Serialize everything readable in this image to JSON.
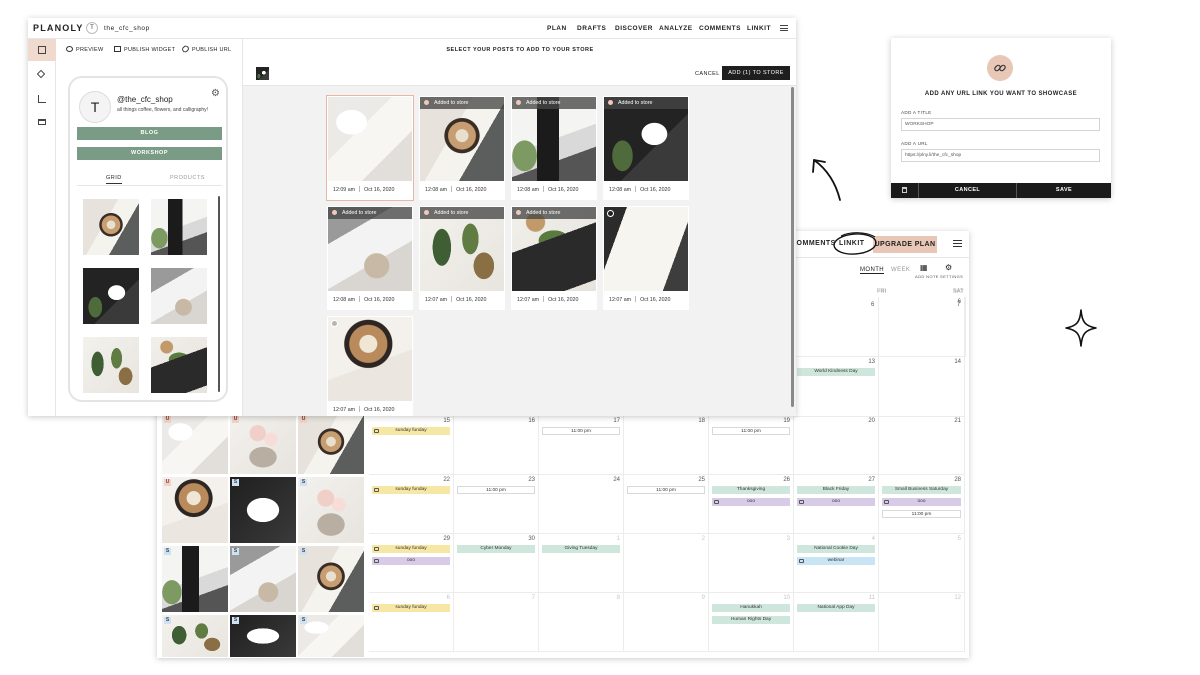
{
  "calendar": {
    "nav": {
      "comments": "COMMENTS",
      "linkit": "LINKIT",
      "upgrade": "UPGRADE PLAN"
    },
    "views": {
      "month": "MONTH",
      "week": "WEEK",
      "add_note": "ADD NOTE",
      "settings": "SETTINGS"
    },
    "day_heads": {
      "fri": "FRI",
      "sat": "SAT"
    },
    "row1": [
      "6",
      "7"
    ],
    "row2": [
      "13",
      "14"
    ],
    "row3": [
      "15",
      "16",
      "17",
      "18",
      "19",
      "20",
      "21"
    ],
    "row4": [
      "22",
      "23",
      "24",
      "25",
      "26",
      "27",
      "28"
    ],
    "row5": [
      "29",
      "30",
      "1",
      "2",
      "3",
      "4",
      "5"
    ],
    "row6": [
      "6",
      "7",
      "8",
      "9",
      "10",
      "11",
      "12"
    ],
    "events": {
      "world_kindness": "World Kindness Day",
      "sunday_funday": "sunday funday",
      "time_1100": "11:00 pm",
      "thanksgiving": "Thanksgiving",
      "black_friday": "Black Friday",
      "small_business": "Small Business Saturday",
      "ooo": "ooo",
      "cyber_monday": "Cyber Monday",
      "giving_tuesday": "Giving Tuesday",
      "national_cookie": "National Cookie Day",
      "webinar": "webinar",
      "hanukkah": "Hanukkah",
      "human_rights": "Human Rights Day",
      "national_app": "National App Day"
    },
    "badges": {
      "u": "U",
      "s": "S"
    }
  },
  "app": {
    "brand": "PLANOLY",
    "account_initial": "T",
    "account_name": "the_cfc_shop",
    "nav": [
      "PLAN",
      "DRAFTS",
      "DISCOVER",
      "ANALYZE",
      "COMMENTS",
      "LINKIT"
    ],
    "toolbar": {
      "preview": "PREVIEW",
      "publish_widget": "PUBLISH WIDGET",
      "publish_url": "PUBLISH URL"
    }
  },
  "profile": {
    "initial": "T",
    "handle": "@the_cfc_shop",
    "bio": "all things coffee, flowers, and calligraphy!",
    "links": [
      "BLOG",
      "WORKSHOP"
    ],
    "tabs": [
      "GRID",
      "PRODUCTS"
    ]
  },
  "picker": {
    "heading": "SELECT YOUR POSTS TO ADD TO YOUR STORE",
    "cancel": "CANCEL",
    "add_button": "ADD (1) TO STORE",
    "added_label": "Added to store",
    "date": "Oct 16, 2020",
    "posts": [
      {
        "time": "12:09 am"
      },
      {
        "time": "12:08 am"
      },
      {
        "time": "12:08 am"
      },
      {
        "time": "12:08 am"
      },
      {
        "time": "12:08 am"
      },
      {
        "time": "12:07 am"
      },
      {
        "time": "12:07 am"
      },
      {
        "time": "12:07 am"
      },
      {
        "time": "12:07 am"
      }
    ]
  },
  "modal": {
    "title": "ADD ANY URL LINK YOU WANT TO SHOWCASE",
    "title_label": "ADD A TITLE",
    "title_value": "WORKSHOP",
    "url_label": "ADD A URL",
    "url_value": "https://plny.li/the_cfc_shop",
    "cancel": "CANCEL",
    "save": "SAVE"
  },
  "colors": {
    "accent_peach": "#e8c7b7",
    "link_button_green": "#7a9b85",
    "event_yellow": "#f6e7a5",
    "event_green": "#cfe6dc",
    "event_purple": "#d8cbe8",
    "event_blue": "#c9e4f4"
  }
}
